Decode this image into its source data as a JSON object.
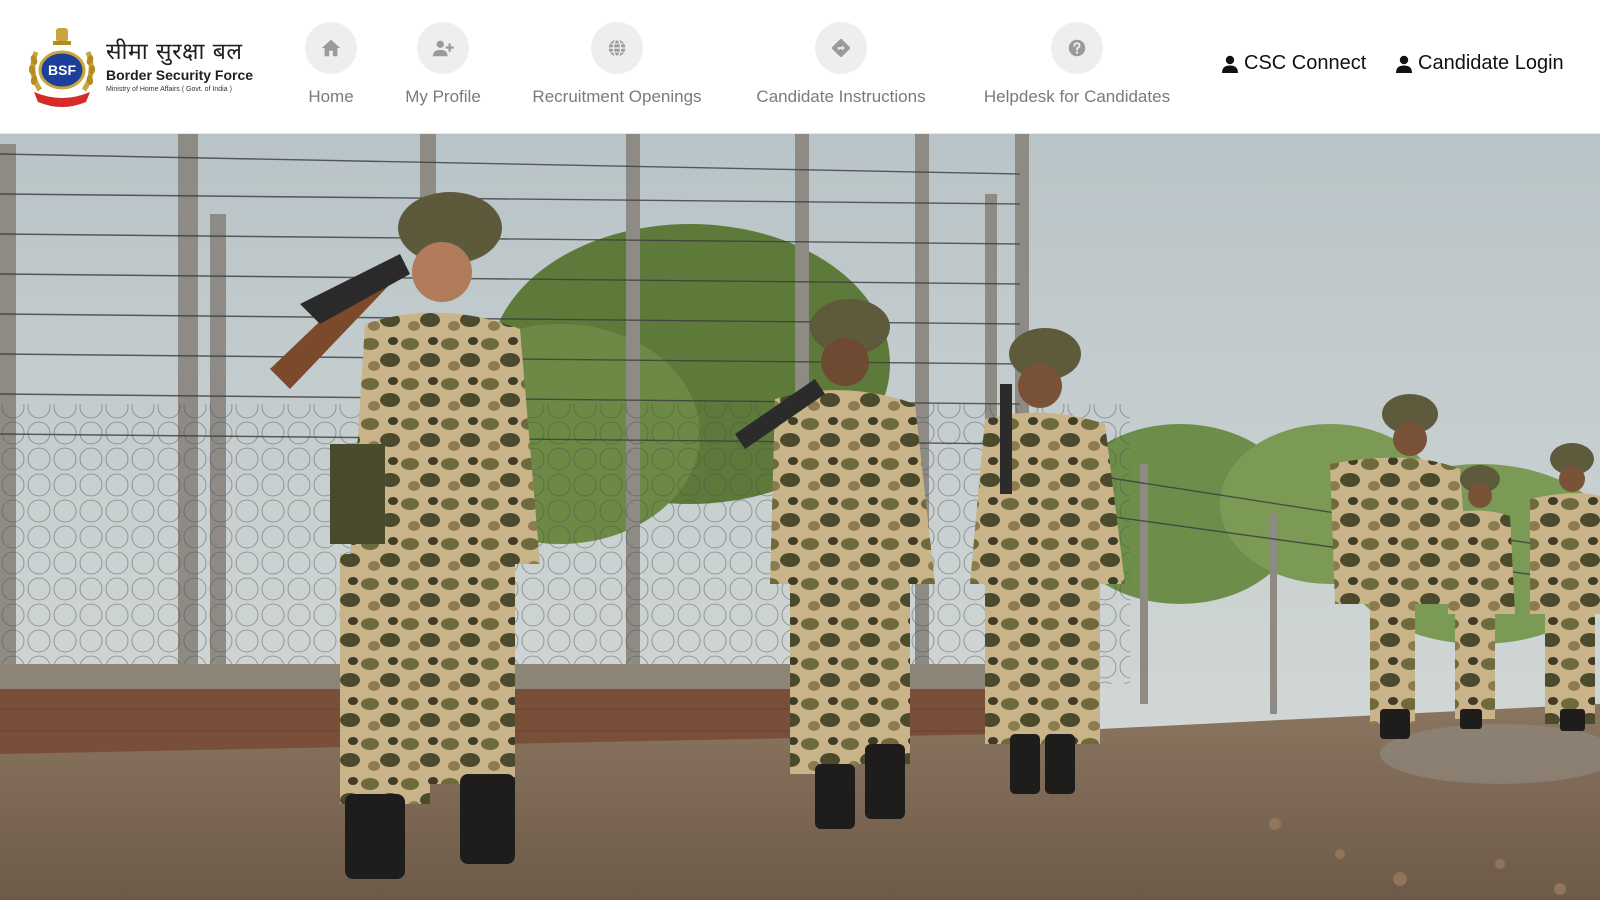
{
  "logo": {
    "badge_text": "BSF",
    "hindi_name": "सीमा सुरक्षा बल",
    "english_name": "Border Security Force",
    "ministry": "Ministry of Home Affairs ( Govt. of India )"
  },
  "nav": {
    "items": [
      {
        "label": "Home",
        "icon": "home-icon"
      },
      {
        "label": "My Profile",
        "icon": "user-plus-icon"
      },
      {
        "label": "Recruitment Openings",
        "icon": "globe-icon"
      },
      {
        "label": "Candidate Instructions",
        "icon": "directions-diamond-icon"
      },
      {
        "label": "Helpdesk for Candidates",
        "icon": "question-circle-icon"
      }
    ]
  },
  "auth": {
    "csc_label": "CSC Connect",
    "login_label": "Candidate Login"
  },
  "colors": {
    "nav_icon_bg": "#eeeeee",
    "nav_icon_fg": "#9a9a9a",
    "nav_text": "#7a7a7a",
    "auth_text": "#111111",
    "camo_sand": "#c9b48a",
    "camo_olive": "#6f6a3e"
  }
}
